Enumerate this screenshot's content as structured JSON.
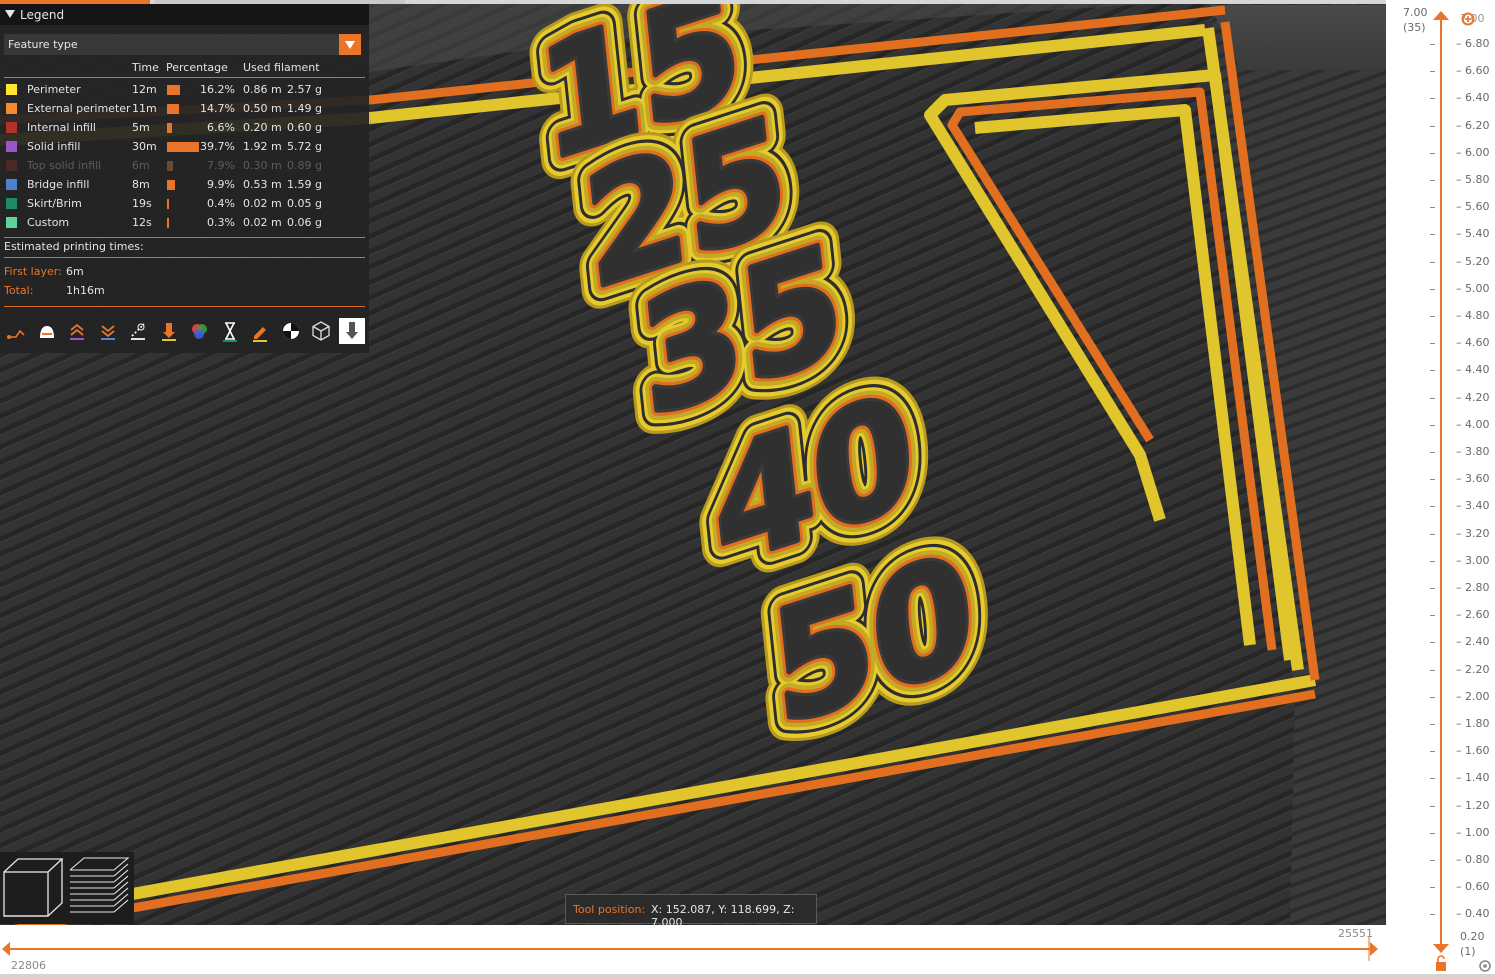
{
  "legend": {
    "title": "Legend",
    "view_type": "Feature type",
    "columns": {
      "time": "Time",
      "percentage": "Percentage",
      "filament": "Used filament"
    },
    "rows": [
      {
        "name": "Perimeter",
        "color": "#ffe633",
        "time": "12m",
        "percent": "16.2%",
        "length": "0.86 m",
        "weight": "2.57 g",
        "share": 0.162,
        "visible": true
      },
      {
        "name": "External perimeter",
        "color": "#f58a2d",
        "time": "11m",
        "percent": "14.7%",
        "length": "0.50 m",
        "weight": "1.49 g",
        "share": 0.147,
        "visible": true
      },
      {
        "name": "Internal infill",
        "color": "#b0322a",
        "time": "5m",
        "percent": "6.6%",
        "length": "0.20 m",
        "weight": "0.60 g",
        "share": 0.066,
        "visible": true
      },
      {
        "name": "Solid infill",
        "color": "#9955cc",
        "time": "30m",
        "percent": "39.7%",
        "length": "1.92 m",
        "weight": "5.72 g",
        "share": 0.397,
        "visible": true
      },
      {
        "name": "Top solid infill",
        "color": "#5a2a26",
        "time": "6m",
        "percent": "7.9%",
        "length": "0.30 m",
        "weight": "0.89 g",
        "share": 0.079,
        "visible": false
      },
      {
        "name": "Bridge infill",
        "color": "#4f7fcf",
        "time": "8m",
        "percent": "9.9%",
        "length": "0.53 m",
        "weight": "1.59 g",
        "share": 0.099,
        "visible": true
      },
      {
        "name": "Skirt/Brim",
        "color": "#1f8a6a",
        "time": "19s",
        "percent": "0.4%",
        "length": "0.02 m",
        "weight": "0.05 g",
        "share": 0.004,
        "visible": true
      },
      {
        "name": "Custom",
        "color": "#5ed39a",
        "time": "12s",
        "percent": "0.3%",
        "length": "0.02 m",
        "weight": "0.06 g",
        "share": 0.003,
        "visible": true
      }
    ],
    "estimated_label": "Estimated printing times:",
    "first_layer_label": "First layer:",
    "first_layer_value": "6m",
    "total_label": "Total:",
    "total_value": "1h16m",
    "toolbar_icons": [
      "travel-icon",
      "wipe-icon",
      "retractions-icon",
      "deretractions-icon",
      "seams-icon",
      "tool-changes-icon",
      "color-changes-icon",
      "pause-icon",
      "custom-gcode-icon",
      "center-of-gravity-icon",
      "shells-icon",
      "tool-marker-icon"
    ]
  },
  "model": {
    "labels": [
      "15",
      "25",
      "35",
      "40",
      "50"
    ]
  },
  "tool_position": {
    "label": "Tool position:",
    "value": "X: 152.087, Y: 118.699, Z: 7.000"
  },
  "vertical_slider": {
    "top_value": "7.00",
    "top_layer": "(35)",
    "top_thumb_value": "7.00",
    "bottom_value": "0.20",
    "bottom_layer": "(1)",
    "ticks": [
      "6.80",
      "6.60",
      "6.40",
      "6.20",
      "6.00",
      "5.80",
      "5.60",
      "5.40",
      "5.20",
      "5.00",
      "4.80",
      "4.60",
      "4.40",
      "4.20",
      "4.00",
      "3.80",
      "3.60",
      "3.40",
      "3.20",
      "3.00",
      "2.80",
      "2.60",
      "2.40",
      "2.20",
      "2.00",
      "1.80",
      "1.60",
      "1.40",
      "1.20",
      "1.00",
      "0.80",
      "0.60",
      "0.40"
    ]
  },
  "horizontal_slider": {
    "left_value": "22806",
    "right_value": "25551"
  },
  "colors": {
    "accent": "#e8752a",
    "perimeter": "#e8cf2e",
    "external": "#e06a1e",
    "bed": "#2e2e2e"
  }
}
